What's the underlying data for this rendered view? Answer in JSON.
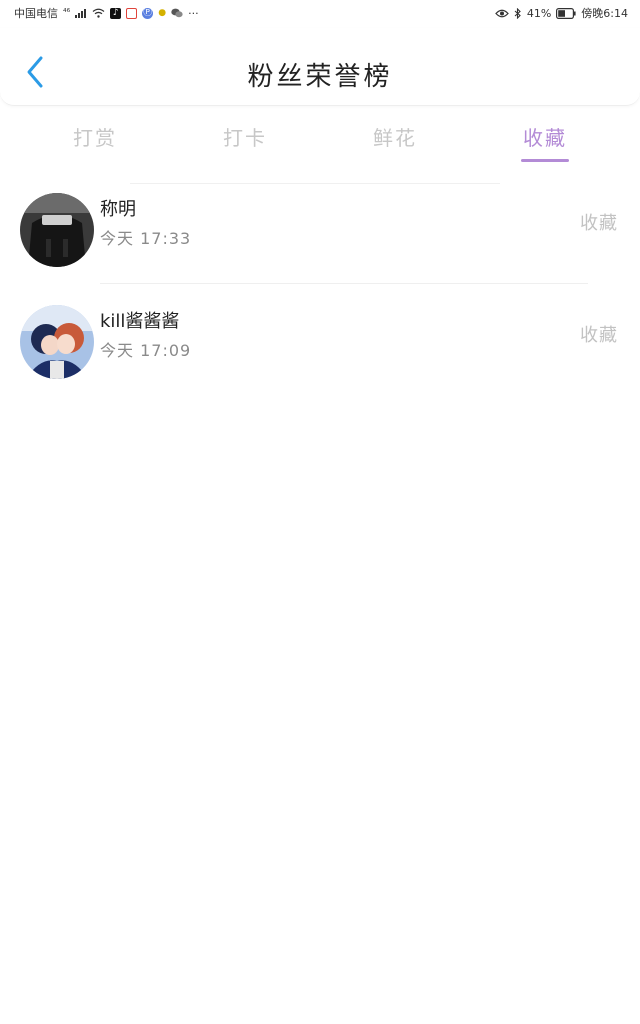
{
  "status_bar": {
    "carrier": "中国电信",
    "signal_label": "⁴⁶",
    "battery": "41%",
    "time": "傍晚6:14",
    "more": "···"
  },
  "header": {
    "title": "粉丝荣誉榜"
  },
  "tabs": [
    {
      "label": "打赏"
    },
    {
      "label": "打卡"
    },
    {
      "label": "鲜花"
    },
    {
      "label": "收藏"
    }
  ],
  "active_tab": "收藏",
  "list": [
    {
      "name": "称明",
      "time": "今天 17:33",
      "action": "收藏"
    },
    {
      "name": "kill酱酱酱",
      "time": "今天 17:09",
      "action": "收藏"
    }
  ],
  "colors": {
    "accent": "#b38bd6",
    "back_arrow": "#2b9be6",
    "tab_inactive": "#c7c7c7"
  }
}
